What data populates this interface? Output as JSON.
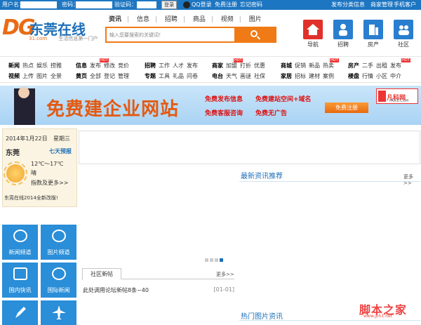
{
  "topbar": {
    "username_label": "用户名：",
    "password_label": "密码：",
    "captcha_label": "验证码：",
    "login_button": "登录",
    "qq_login": "QQ登录",
    "register": "免费注册",
    "forgot": "忘记密码",
    "right_links": [
      "发布分类信息",
      "商家管理",
      "手机客户端"
    ]
  },
  "logo": {
    "mark": "DG",
    "name": "东莞在线",
    "domain": "31.com",
    "slogan": "生活信息第一门户"
  },
  "search": {
    "tabs": [
      "资讯",
      "信息",
      "招聘",
      "商品",
      "视频",
      "图片"
    ],
    "active_tab": "资讯",
    "placeholder": "输入您要搜索的关键词！"
  },
  "quick_links": [
    {
      "label": "导航",
      "color": "#e1302a",
      "icon": "home-icon"
    },
    {
      "label": "招聘",
      "color": "#2a7ecf",
      "icon": "person-icon"
    },
    {
      "label": "房产",
      "color": "#2a7ecf",
      "icon": "building-icon"
    },
    {
      "label": "社区",
      "color": "#2a7ecf",
      "icon": "community-icon"
    }
  ],
  "nav": {
    "row1": [
      [
        "新闻",
        "热点",
        "娱乐",
        "捞雅"
      ],
      [
        "信息",
        "发布",
        "修改",
        "竞价"
      ],
      [
        "招聘",
        "工作",
        "人才",
        "发布"
      ],
      [
        "商家",
        "加盟",
        "打折",
        "优惠"
      ],
      [
        "商城",
        "促销",
        "新品",
        "热卖"
      ],
      [
        "房产",
        "二手",
        "出租",
        "发布"
      ]
    ],
    "row2": [
      [
        "视频",
        "上传",
        "图片",
        "全景"
      ],
      [
        "黄页",
        "全部",
        "登记",
        "管理"
      ],
      [
        "专题",
        "工具",
        "礼品",
        "问卷"
      ],
      [
        "电台",
        "天气",
        "画谜",
        "社保"
      ],
      [
        "家居",
        "招标",
        "建材",
        "案例"
      ],
      [
        "楼盘",
        "行情",
        "小区",
        "中介"
      ]
    ],
    "hot_badge": "HOT"
  },
  "banner": {
    "headline": "免费建企业网站",
    "promo_line1": "免费发布信息",
    "promo_line2": "免费客服咨询",
    "promo_line3": "免费建站空间+域名",
    "promo_line4": "免费无广告",
    "register_button": "免费注册",
    "brand": "凡科网",
    "brand_url": "FAIKE.COM"
  },
  "weather": {
    "date": "2014年1月22日",
    "weekday": "星期三",
    "city": "东莞",
    "forecast_link": "七天预报",
    "temp": "12℃～17℃",
    "condition": "晴",
    "index_link": "指数及更多>>",
    "notice": "东莞在线2014全新改版!"
  },
  "tiles": [
    {
      "label": "新闻频道",
      "icon": "globe-icon"
    },
    {
      "label": "图片频道",
      "icon": "globe-icon"
    },
    {
      "label": "国内快讯",
      "icon": "camera-icon"
    },
    {
      "label": "国际新闻",
      "icon": "globe-icon"
    },
    {
      "label": "",
      "icon": "pen-icon"
    },
    {
      "label": "",
      "icon": "plane-icon"
    }
  ],
  "sections": {
    "latest_news": {
      "title": "最新资讯推荐",
      "more": "更多>>"
    },
    "community": {
      "title": "社区新帖",
      "more": "更多>>",
      "items": [
        {
          "text": "此处调用论坛新帖8条~40",
          "date": "[01-01]"
        }
      ]
    },
    "hot_pics": {
      "title": "热门图片资讯"
    }
  },
  "carousel": {
    "count": 4,
    "active": 3
  },
  "watermark": {
    "main": "脚本之家",
    "sub": "www.jb51.net"
  }
}
